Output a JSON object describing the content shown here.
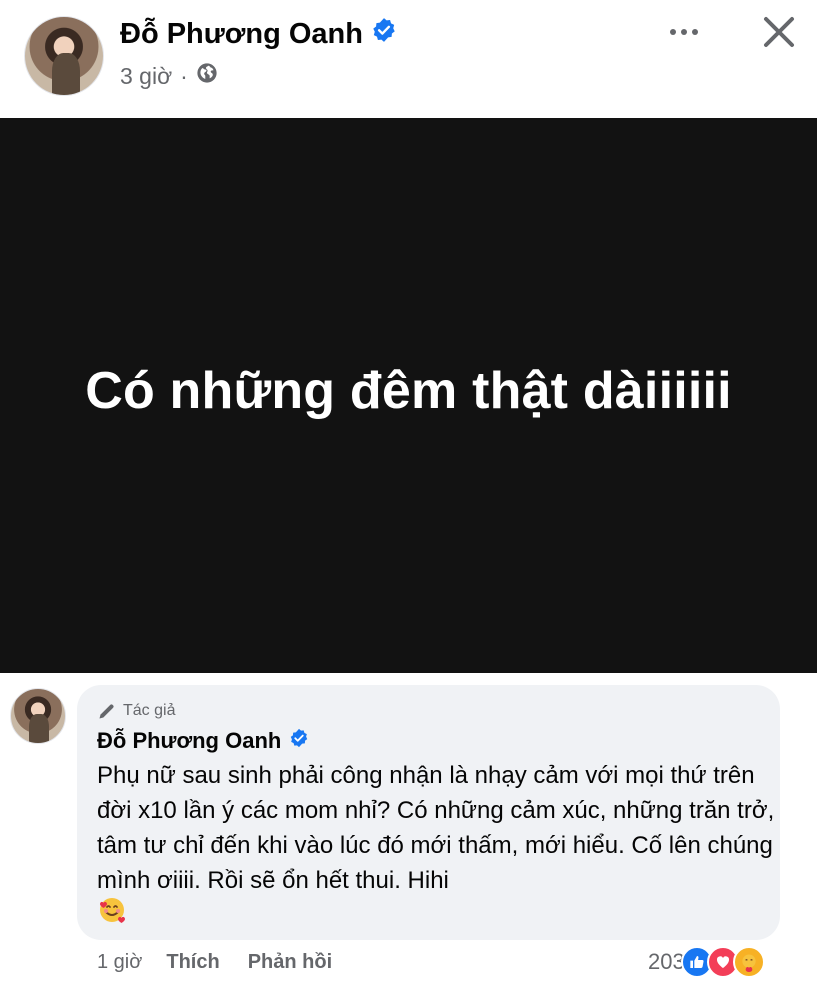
{
  "post": {
    "author": "Đỗ Phương Oanh",
    "time": "3 giờ",
    "audience_icon": "globe-icon",
    "text": "Có những đêm thật dàiiiiii"
  },
  "comment": {
    "badge": "Tác giả",
    "author": "Đỗ Phương Oanh",
    "text": "Phụ nữ sau sinh phải công nhận là nhạy cảm với mọi thứ trên đời x10 lần ý các mom nhỉ? Có những cảm xúc, những trăn trở, tâm tư chỉ đến khi vào lúc đó mới thấm, mới hiểu. Cố lên chúng mình ơiiii. Rồi sẽ ổn hết thui. Hihi",
    "emoji": "smiling-face-with-hearts-icon",
    "time": "1 giờ",
    "like_label": "Thích",
    "reply_label": "Phản hồi",
    "reaction_count": "203",
    "reactions": [
      "like-icon",
      "love-icon",
      "care-icon"
    ]
  },
  "colors": {
    "verified": "#1877f2",
    "post_background": "#121212",
    "bubble": "#f0f2f5",
    "secondary_text": "#65676b"
  }
}
